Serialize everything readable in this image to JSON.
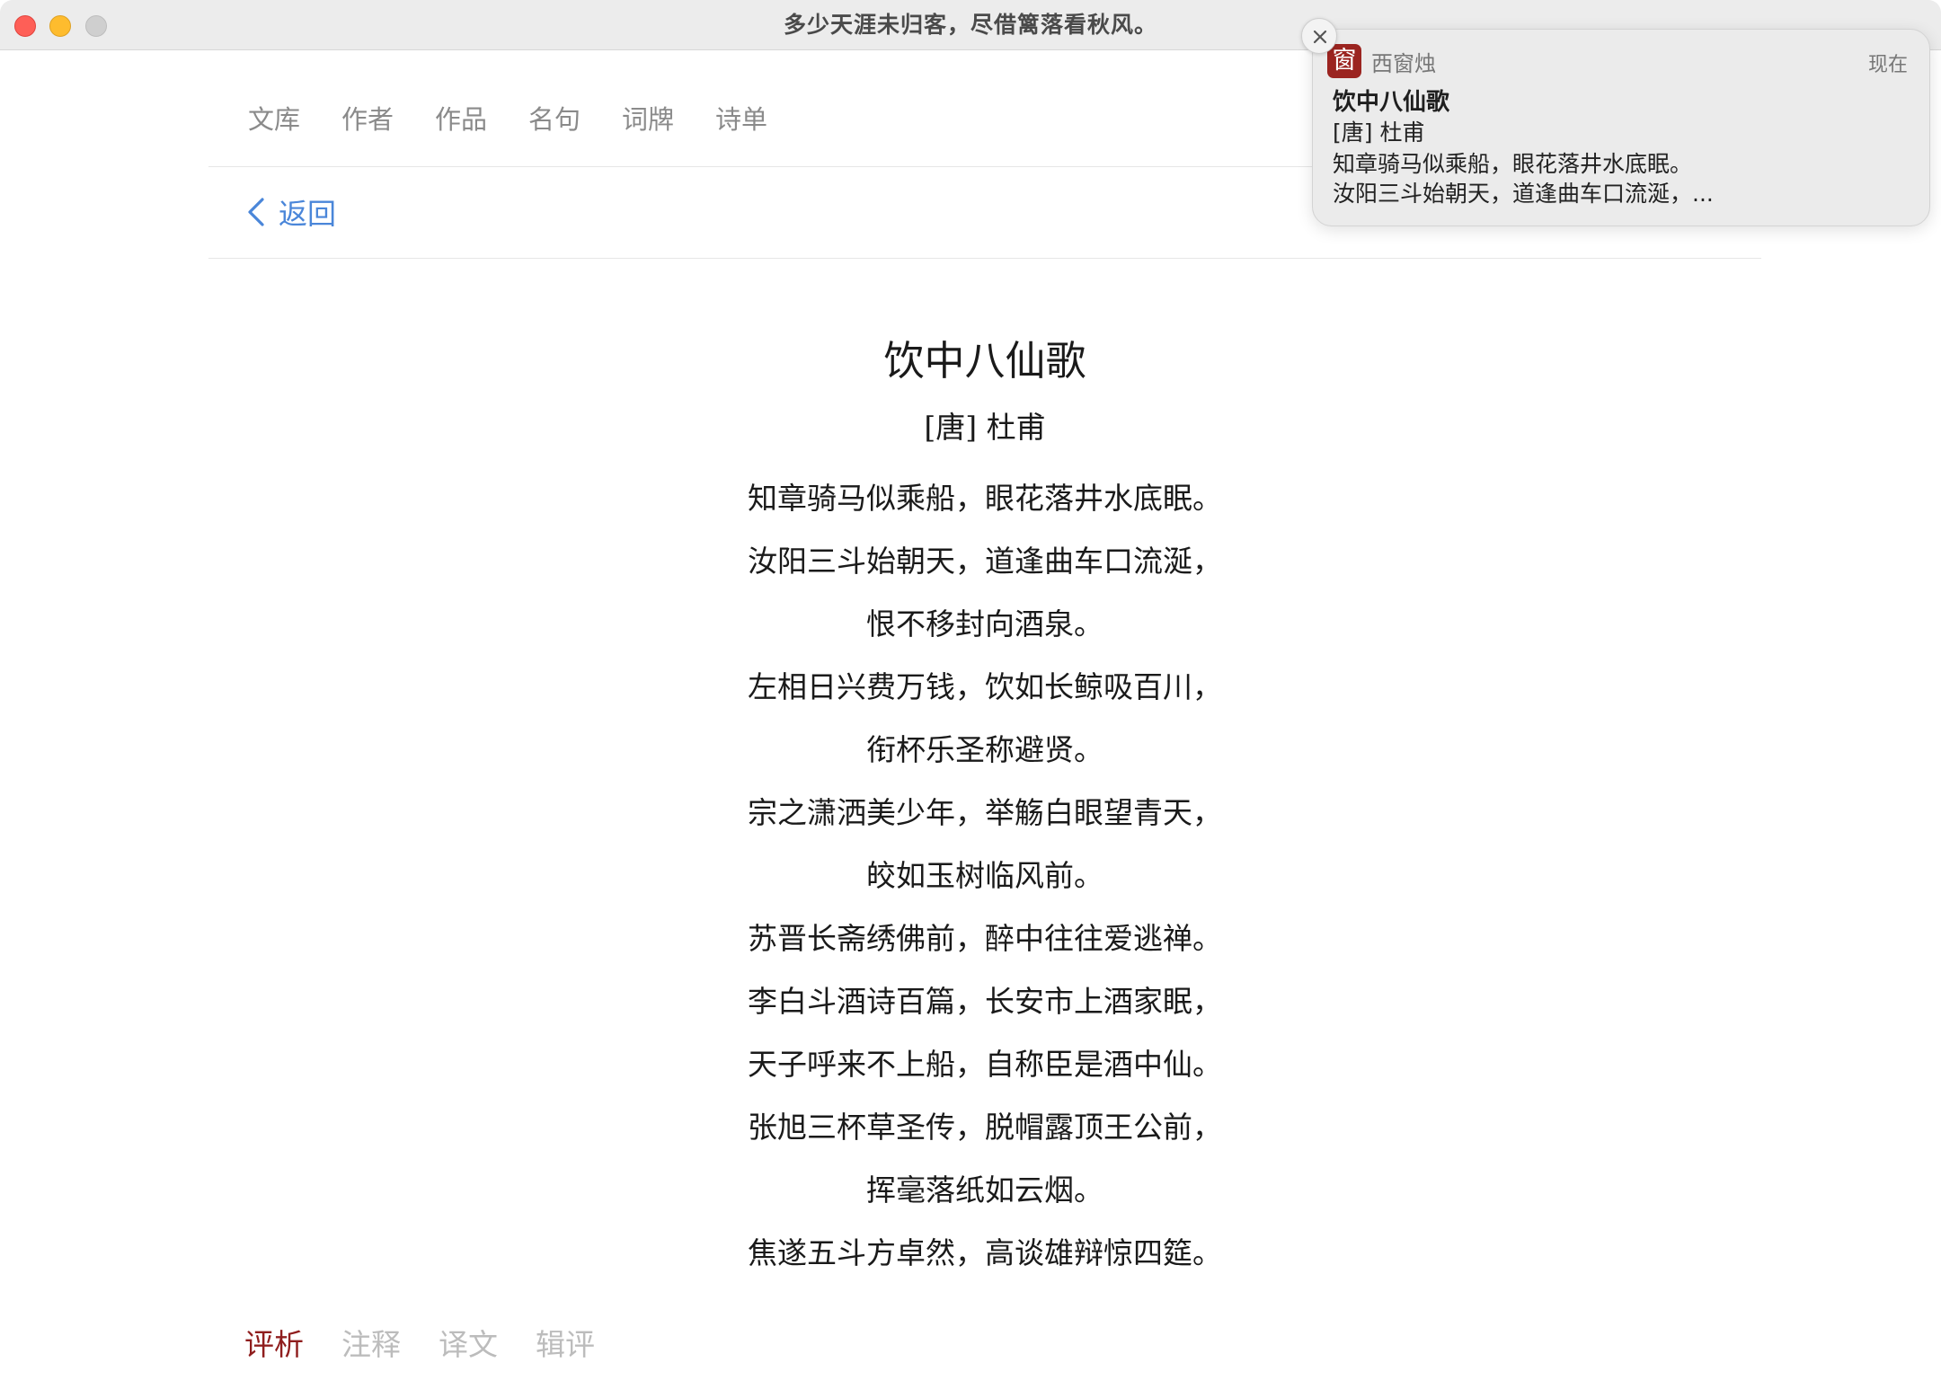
{
  "window": {
    "title": "多少天涯未归客，尽借篱落看秋风。"
  },
  "nav": {
    "items": [
      {
        "label": "文库"
      },
      {
        "label": "作者"
      },
      {
        "label": "作品"
      },
      {
        "label": "名句"
      },
      {
        "label": "词牌"
      },
      {
        "label": "诗单"
      }
    ]
  },
  "back": {
    "label": "返回"
  },
  "poem": {
    "title": "饮中八仙歌",
    "author": "[唐] 杜甫",
    "lines": [
      "知章骑马似乘船，眼花落井水底眠。",
      "汝阳三斗始朝天，道逢曲车口流涎，",
      "恨不移封向酒泉。",
      "左相日兴费万钱，饮如长鲸吸百川，",
      "衔杯乐圣称避贤。",
      "宗之潇洒美少年，举觞白眼望青天，",
      "皎如玉树临风前。",
      "苏晋长斋绣佛前，醉中往往爱逃禅。",
      "李白斗酒诗百篇，长安市上酒家眠，",
      "天子呼来不上船，自称臣是酒中仙。",
      "张旭三杯草圣传，脱帽露顶王公前，",
      "挥毫落纸如云烟。",
      "焦遂五斗方卓然，高谈雄辩惊四筵。"
    ]
  },
  "tabs": [
    {
      "label": "评析",
      "active": true
    },
    {
      "label": "注释",
      "active": false
    },
    {
      "label": "译文",
      "active": false
    },
    {
      "label": "辑评",
      "active": false
    }
  ],
  "notification": {
    "app_icon_char": "窗",
    "app_name": "西窗烛",
    "time": "现在",
    "title": "饮中八仙歌",
    "author": "[唐] 杜甫",
    "body_line1": "知章骑马似乘船，眼花落井水底眠。",
    "body_line2": "汝阳三斗始朝天，道逢曲车口流涎，..."
  },
  "colors": {
    "accent_link": "#4a86d9",
    "active_tab": "#8f1d1d",
    "app_icon_bg": "#9b2420"
  }
}
